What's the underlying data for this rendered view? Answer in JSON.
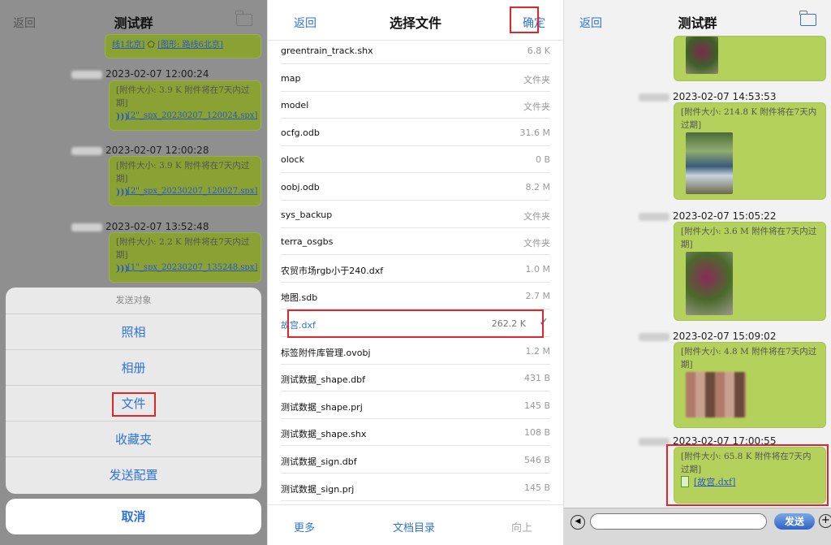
{
  "left": {
    "back": "返回",
    "title": "测试群",
    "partial_text1": "线1北京]",
    "partial_text2": "[图形: 路线6北京]",
    "messages": [
      {
        "time": "2023-02-07 12:00:24",
        "text": "[附件大小: 3.9 K 附件将在7天内过期]",
        "file": "[2\"_spx_20230207_120024.spx]"
      },
      {
        "time": "2023-02-07 12:00:28",
        "text": "[附件大小: 3.9 K 附件将在7天内过期]",
        "file": "[2\"_spx_20230207_120027.spx]"
      },
      {
        "time": "2023-02-07 13:52:48",
        "text": "[附件大小: 2.2 K 附件将在7天内过期]",
        "file": "[1\"_spx_20230207_135248.spx]"
      }
    ],
    "sheet": {
      "caption": "发送对象",
      "items": [
        "照相",
        "相册",
        "文件",
        "收藏夹",
        "发送配置"
      ],
      "cancel": "取消"
    }
  },
  "middle": {
    "back": "返回",
    "title": "选择文件",
    "confirm": "确定",
    "files": [
      {
        "name": "greentrain_track.shx",
        "size": "6.8 K"
      },
      {
        "name": "map",
        "size": "文件夹"
      },
      {
        "name": "model",
        "size": "文件夹"
      },
      {
        "name": "ocfg.odb",
        "size": "31.6 M"
      },
      {
        "name": "olock",
        "size": "0 B"
      },
      {
        "name": "oobj.odb",
        "size": "8.2 M"
      },
      {
        "name": "sys_backup",
        "size": "文件夹"
      },
      {
        "name": "terra_osgbs",
        "size": "文件夹"
      },
      {
        "name": "农贸市场rgb小于240.dxf",
        "size": "1.0 M"
      },
      {
        "name": "地图.sdb",
        "size": "2.7 M"
      },
      {
        "name": "故宫.dxf",
        "size": "262.2 K",
        "selected": true
      },
      {
        "name": "标签附件库管理.ovobj",
        "size": "1.2 M"
      },
      {
        "name": "测试数据_shape.dbf",
        "size": "431 B"
      },
      {
        "name": "测试数据_shape.prj",
        "size": "145 B"
      },
      {
        "name": "测试数据_shape.shx",
        "size": "108 B"
      },
      {
        "name": "测试数据_sign.dbf",
        "size": "546 B"
      },
      {
        "name": "测试数据_sign.prj",
        "size": "145 B"
      }
    ],
    "check": "✓",
    "footer": {
      "more": "更多",
      "docs": "文档目录",
      "up": "向上"
    }
  },
  "right": {
    "back": "返回",
    "title": "测试群",
    "messages": [
      {
        "time": "2023-02-07 14:53:53",
        "text": "[附件大小: 214.8 K 附件将在7天内过期]"
      },
      {
        "time": "2023-02-07 15:05:22",
        "text": "[附件大小: 3.6 M 附件将在7天内过期]"
      },
      {
        "time": "2023-02-07 15:09:02",
        "text": "[附件大小: 4.8 M 附件将在7天内过期]"
      },
      {
        "time": "2023-02-07 17:00:55",
        "text": "[附件大小: 65.8 K 附件将在7天内过期]",
        "file": "[故宫.dxf]"
      }
    ],
    "send": "发送"
  },
  "colors": {
    "accent": "#2e74d8",
    "highlight": "#e0262a",
    "bubble": "#b4d15c"
  }
}
